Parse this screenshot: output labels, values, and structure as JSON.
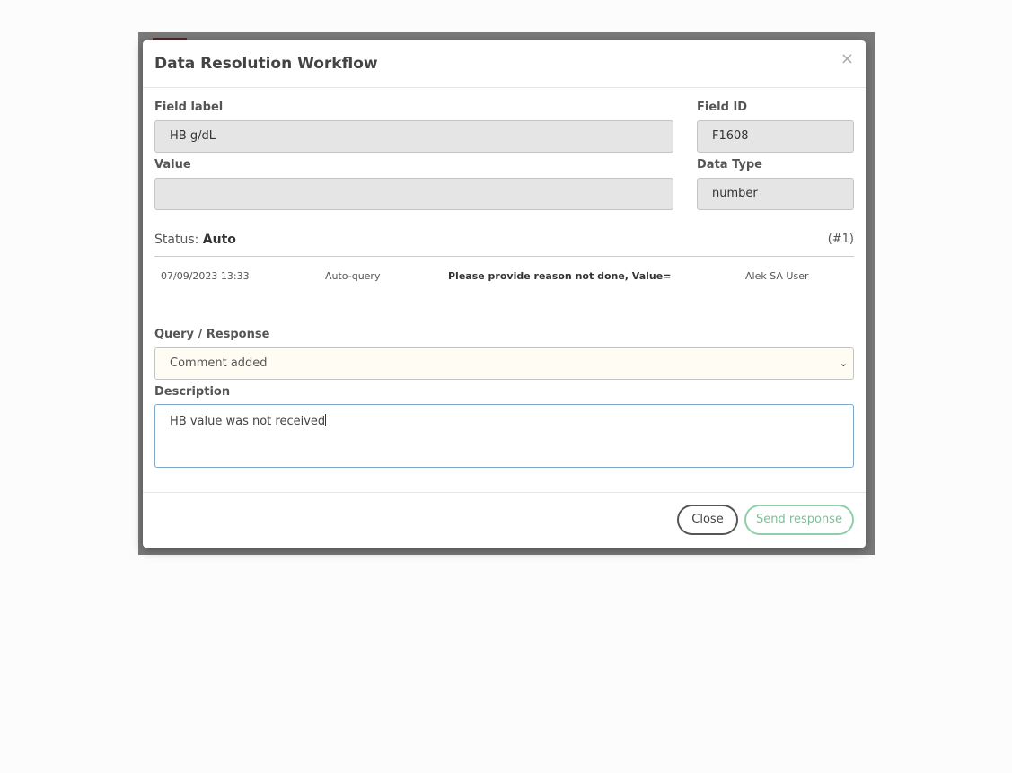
{
  "modal": {
    "title": "Data Resolution Workflow",
    "close_icon": "close-icon"
  },
  "fields": {
    "field_label": {
      "label": "Field label",
      "value": "HB g/dL"
    },
    "field_id": {
      "label": "Field ID",
      "value": "F1608"
    },
    "value": {
      "label": "Value",
      "value": ""
    },
    "data_type": {
      "label": "Data Type",
      "value": "number"
    }
  },
  "status": {
    "prefix": "Status:",
    "value": "Auto",
    "number": "(#1)"
  },
  "history": [
    {
      "date": "07/09/2023 13:33",
      "type": "Auto-query",
      "message": "Please provide reason not done, Value=",
      "user": "Alek SA User"
    }
  ],
  "query": {
    "label": "Query / Response",
    "selected": "Comment added"
  },
  "description": {
    "label": "Description",
    "value": "HB value was not received"
  },
  "buttons": {
    "close": "Close",
    "send": "Send response"
  }
}
